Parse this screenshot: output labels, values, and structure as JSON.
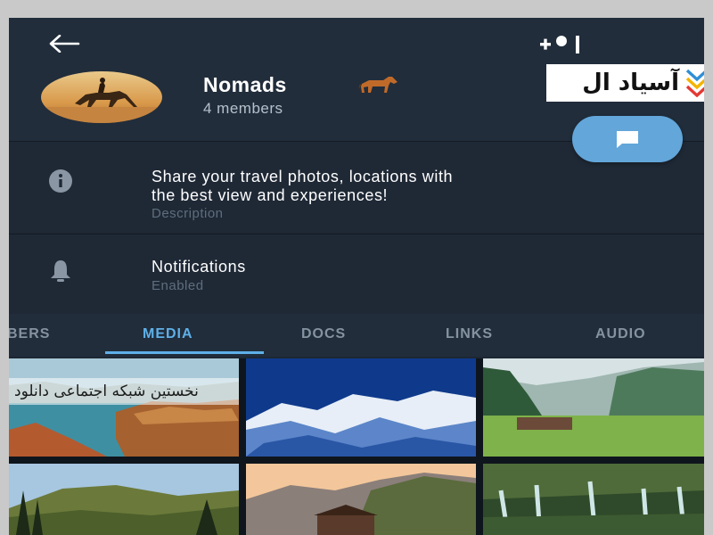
{
  "header": {
    "title": "Nomads",
    "subtitle": "4 members"
  },
  "watermark": {
    "logo_text": "آسیاد ال",
    "banner_text": "نخستین شبکه اجتماعی دانلود"
  },
  "description": {
    "text_line1": "Share your travel photos, locations with",
    "text_line2": "the best view and experiences!",
    "label": "Description"
  },
  "notifications": {
    "title": "Notifications",
    "status": "Enabled"
  },
  "tabs": [
    {
      "label": "BERS"
    },
    {
      "label": "MEDIA"
    },
    {
      "label": "DOCS"
    },
    {
      "label": "LINKS"
    },
    {
      "label": "AUDIO"
    }
  ],
  "active_tab": "MEDIA",
  "colors": {
    "accent": "#5fb0e8",
    "fab": "#62a6da",
    "background": "#1d2733"
  },
  "media": [
    {
      "name": "coastal-rock-photo"
    },
    {
      "name": "snowy-mountain-photo"
    },
    {
      "name": "meadow-valley-photo"
    },
    {
      "name": "forest-hill-photo"
    },
    {
      "name": "mountain-cabin-photo"
    },
    {
      "name": "waterfall-photo"
    }
  ]
}
